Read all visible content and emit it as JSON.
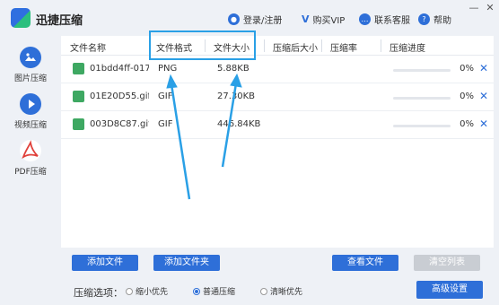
{
  "app": {
    "title": "迅捷压缩"
  },
  "titlebar": {
    "login": "登录/注册",
    "vip": "购买VIP",
    "support": "联系客服",
    "help": "帮助",
    "minimize": "—",
    "close": "✕"
  },
  "sidebar": {
    "items": [
      {
        "label": "图片压缩"
      },
      {
        "label": "视频压缩"
      },
      {
        "label": "PDF压缩"
      }
    ]
  },
  "table": {
    "columns": [
      "文件名称",
      "文件格式",
      "文件大小",
      "压缩后大小",
      "压缩率",
      "压缩进度"
    ],
    "rows": [
      {
        "name": "01bdd4ff-017..",
        "format": "PNG",
        "size": "5.88KB",
        "progress": 0,
        "pct": "0%"
      },
      {
        "name": "01E20D55.gif",
        "format": "GIF",
        "size": "27.30KB",
        "progress": 0,
        "pct": "0%"
      },
      {
        "name": "003D8C87.gif",
        "format": "GIF",
        "size": "446.84KB",
        "progress": 0,
        "pct": "0%"
      }
    ]
  },
  "actions": {
    "add_file": "添加文件",
    "add_folder": "添加文件夹",
    "view_file": "查看文件",
    "clear_list": "清空列表",
    "advanced": "高级设置"
  },
  "options": {
    "label": "压缩选项：",
    "choices": [
      {
        "label": "缩小优先",
        "selected": false
      },
      {
        "label": "普通压缩",
        "selected": true
      },
      {
        "label": "清晰优先",
        "selected": false
      }
    ]
  },
  "colors": {
    "accent": "#2e6fd8",
    "annotation": "#2aa0e6",
    "file_icon": "#3ea862"
  }
}
